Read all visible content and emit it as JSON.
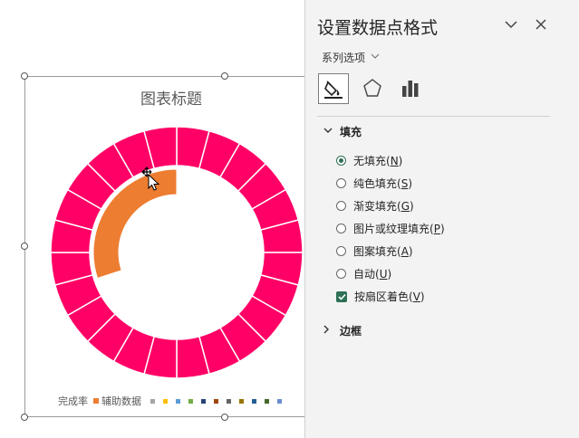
{
  "chart": {
    "title": "图表标题",
    "legend": {
      "items": [
        {
          "label": "完成率",
          "color": "#ff0066"
        },
        {
          "label": "辅助数据",
          "color": "#ed7d31"
        }
      ],
      "extra_swatches": [
        "#a5a5a5",
        "#ffc000",
        "#5b9bd5",
        "#70ad47",
        "#264478",
        "#9e480e",
        "#636363",
        "#997300",
        "#255e91",
        "#43682b",
        "#698ed0"
      ]
    }
  },
  "chart_data": {
    "type": "donut",
    "title": "图表标题",
    "series": [
      {
        "name": "辅助数据",
        "ring": "outer",
        "segments": 24,
        "values": [
          1,
          1,
          1,
          1,
          1,
          1,
          1,
          1,
          1,
          1,
          1,
          1,
          1,
          1,
          1,
          1,
          1,
          1,
          1,
          1,
          1,
          1,
          1,
          1
        ],
        "color": "#ff0066"
      },
      {
        "name": "完成率",
        "ring": "inner",
        "values": [
          0.3,
          0.7
        ],
        "colors": [
          "#ed7d31",
          "none"
        ]
      }
    ],
    "legend": [
      "完成率",
      "辅助数据"
    ]
  },
  "pane": {
    "title": "设置数据点格式",
    "series_options": "系列选项",
    "tabs": [
      {
        "name": "fill-line",
        "icon": "paint-bucket-icon"
      },
      {
        "name": "effects",
        "icon": "pentagon-icon"
      },
      {
        "name": "series-options",
        "icon": "bar-chart-icon"
      }
    ],
    "fill_section": {
      "label": "填充",
      "options": [
        {
          "text": "无填充(",
          "key": "N",
          "tail": ")",
          "checked": true
        },
        {
          "text": "纯色填充(",
          "key": "S",
          "tail": ")",
          "checked": false
        },
        {
          "text": "渐变填充(",
          "key": "G",
          "tail": ")",
          "checked": false
        },
        {
          "text": "图片或纹理填充(",
          "key": "P",
          "tail": ")",
          "checked": false
        },
        {
          "text": "图案填充(",
          "key": "A",
          "tail": ")",
          "checked": false
        },
        {
          "text": "自动(",
          "key": "U",
          "tail": ")",
          "checked": false
        }
      ],
      "vary_colors": {
        "text": "按扇区着色(",
        "key": "V",
        "tail": ")",
        "checked": true
      }
    },
    "border_section": {
      "label": "边框"
    }
  }
}
